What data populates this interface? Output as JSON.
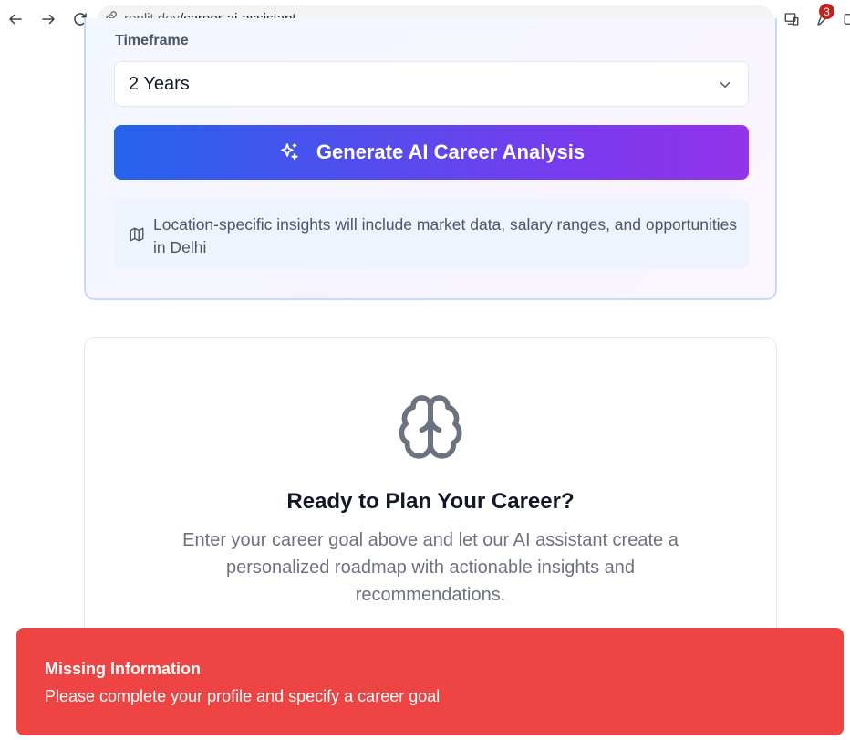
{
  "browser": {
    "url_domain": ".replit.dev",
    "url_path": "/career-ai-assistant",
    "extensions_badge": "3"
  },
  "form": {
    "timeframe_label": "Timeframe",
    "timeframe_value": "2 Years",
    "generate_button_label": "Generate AI Career Analysis",
    "location_info": "Location-specific insights will include market data, salary ranges, and opportunities in Delhi"
  },
  "empty_state": {
    "icon": "brain-icon",
    "title": "Ready to Plan Your Career?",
    "description": "Enter your career goal above and let our AI assistant create a personalized roadmap with actionable insights and recommendations."
  },
  "toast": {
    "title": "Missing Information",
    "message": "Please complete your profile and specify a career goal",
    "color": "#ef4444"
  },
  "colors": {
    "gradient_start": "#2563eb",
    "gradient_end": "#9333ea",
    "card_border": "#bfdbfe"
  }
}
